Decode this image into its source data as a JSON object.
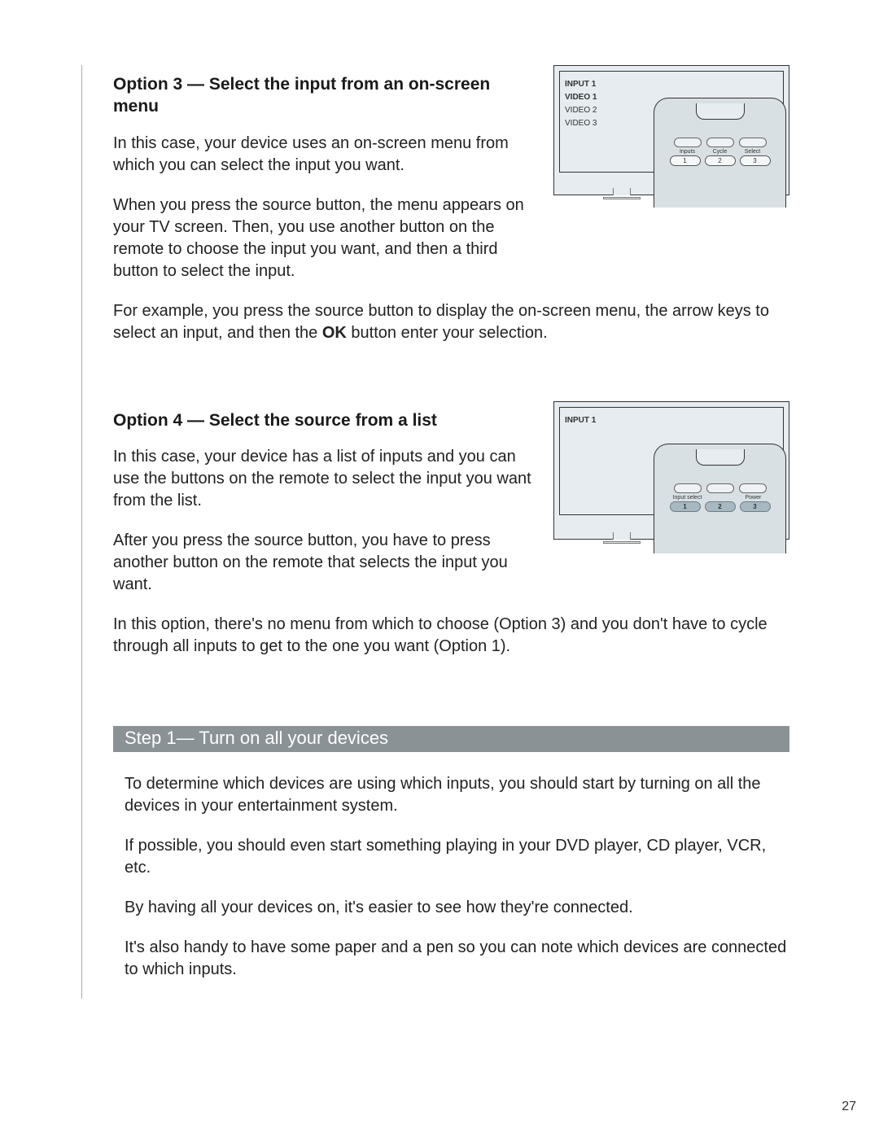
{
  "option3": {
    "heading": "Option 3 — Select the input from an on-screen menu",
    "p1": "In this case, your device uses an on-screen menu from which you can select the input you want.",
    "p2": "When you press the source button, the menu appears on your TV screen. Then, you use another button on the remote to choose the input you want, and then a third button to select the input.",
    "p3a": "For example, you press the source button to display the on-screen menu, the arrow keys to select an input, and then the ",
    "p3b": "OK",
    "p3c": " button enter your selection.",
    "figure": {
      "menu_items": [
        "INPUT 1",
        "VIDEO 1",
        "VIDEO 2",
        "VIDEO 3"
      ],
      "button_labels": [
        "Inputs",
        "Cycle",
        "Select"
      ],
      "button_numbers": [
        "1",
        "2",
        "3"
      ]
    }
  },
  "option4": {
    "heading": "Option 4 — Select the source from a list",
    "p1": "In this case, your device has a list of inputs and you can use the buttons on the remote to select the input you want from the list.",
    "p2": "After you press the source button, you have to press another button on the remote that selects the input you want.",
    "p3": "In this option, there's no menu from which to choose (Option 3) and you don't have to cycle through all inputs to get to the one you want (Option 1).",
    "figure": {
      "menu_items": [
        "INPUT 1"
      ],
      "button_labels": [
        "Input select",
        "",
        "Power"
      ],
      "button_numbers": [
        "1",
        "2",
        "3"
      ]
    }
  },
  "step1": {
    "heading": "Step 1— Turn on all your devices",
    "p1": "To determine which devices are using which inputs, you should start by turning on all the devices in your entertainment system.",
    "p2": "If possible, you should even start something playing in your DVD player, CD player, VCR, etc.",
    "p3": "By having all your devices on, it's easier to see how they're connected.",
    "p4": "It's also handy to have some paper and a pen so you can note which devices are connected to which inputs."
  },
  "page_number": "27"
}
